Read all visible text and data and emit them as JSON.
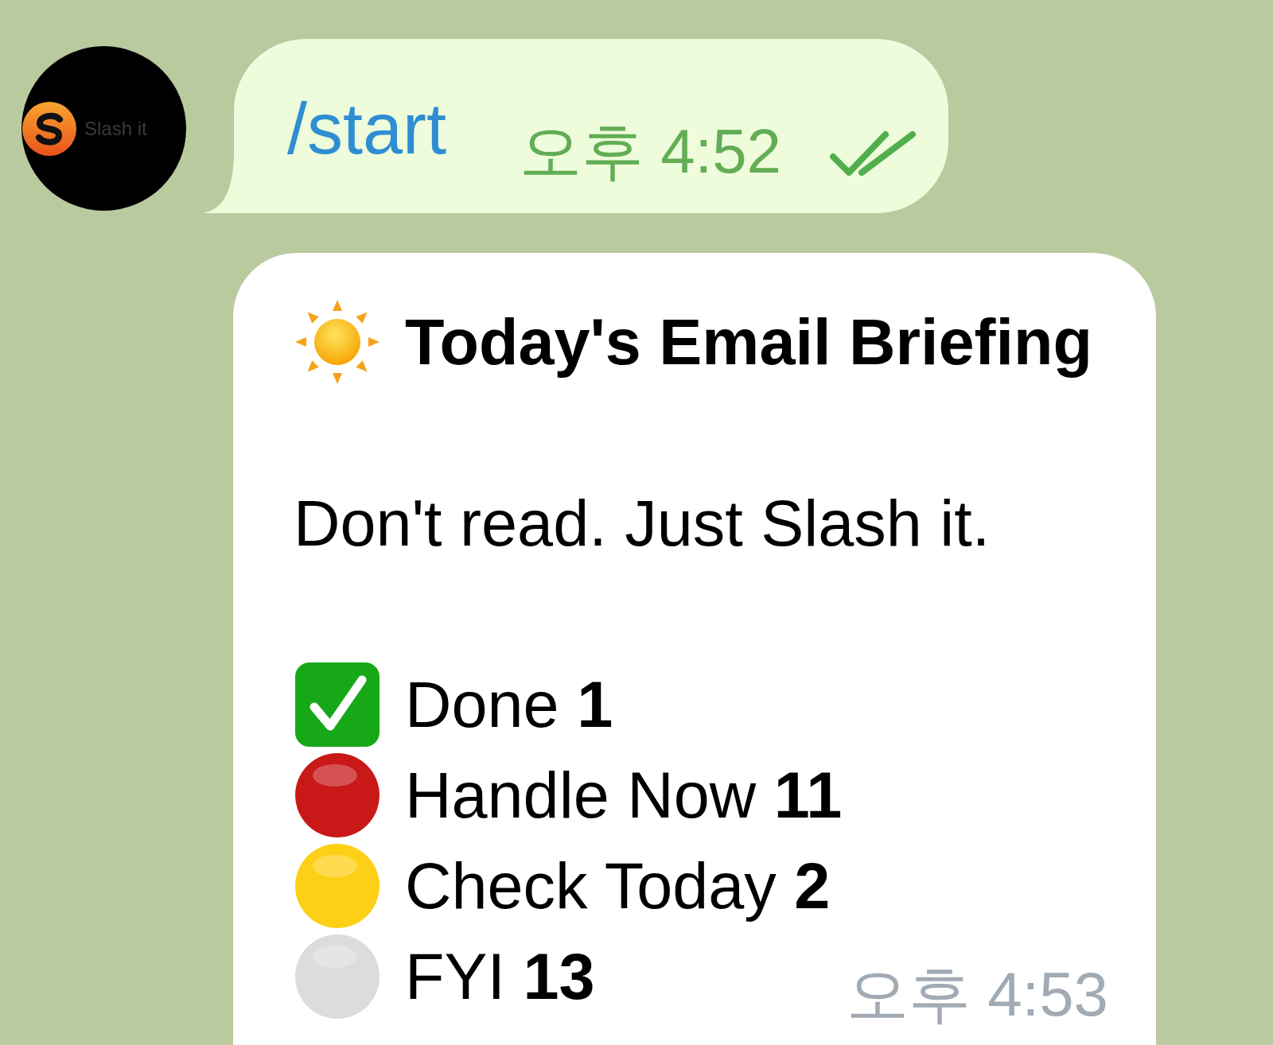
{
  "avatar": {
    "label": "Slash it"
  },
  "command_message": {
    "text": "/start",
    "time": "오후 4:52",
    "read": true
  },
  "briefing_message": {
    "title": "Today's Email Briefing",
    "body": "Don't read. Just Slash it.",
    "items": [
      {
        "kind": "check",
        "color": "#17a817",
        "text": "Done **1**"
      },
      {
        "kind": "dot",
        "color": "#c81818",
        "text": "Handle Now **11**"
      },
      {
        "kind": "dot",
        "color": "#fdd017",
        "text": "Check Today **2**"
      },
      {
        "kind": "dot",
        "color": "#dcdcdc",
        "text": "FYI **13**"
      }
    ],
    "time": "오후 4:53"
  }
}
